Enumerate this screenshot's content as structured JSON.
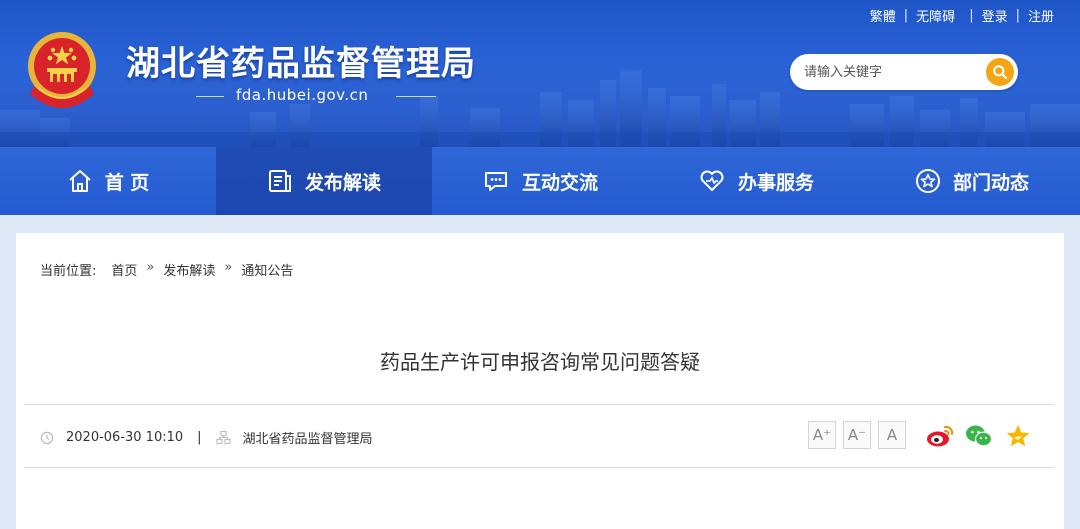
{
  "header": {
    "site_title": "湖北省药品监督管理局",
    "domain": "fda.hubei.gov.cn",
    "top_links": [
      "繁體",
      "无障碍",
      "登录",
      "注册"
    ],
    "search_placeholder": "请输入关键字"
  },
  "nav": {
    "items": [
      {
        "label": "首 页",
        "icon": "home-icon"
      },
      {
        "label": "发布解读",
        "icon": "document-icon"
      },
      {
        "label": "互动交流",
        "icon": "chat-icon"
      },
      {
        "label": "办事服务",
        "icon": "heart-icon"
      },
      {
        "label": "部门动态",
        "icon": "star-icon"
      }
    ],
    "active_index": 1
  },
  "breadcrumb": {
    "label": "当前位置:",
    "items": [
      "首页",
      "发布解读",
      "通知公告"
    ],
    "separator": "»"
  },
  "article": {
    "title": "药品生产许可申报咨询常见问题答疑",
    "date": "2020-06-30 10:10",
    "separator": "|",
    "source": "湖北省药品监督管理局"
  },
  "font_size_buttons": [
    "A⁺",
    "A⁻",
    "A"
  ],
  "share_icons": [
    "weibo-icon",
    "wechat-icon",
    "favorite-icon"
  ],
  "colors": {
    "header_blue": "#2a63d6",
    "nav_active": "#1d4aa8",
    "search_button": "#f5a516",
    "page_bg": "#dfe9f7"
  }
}
